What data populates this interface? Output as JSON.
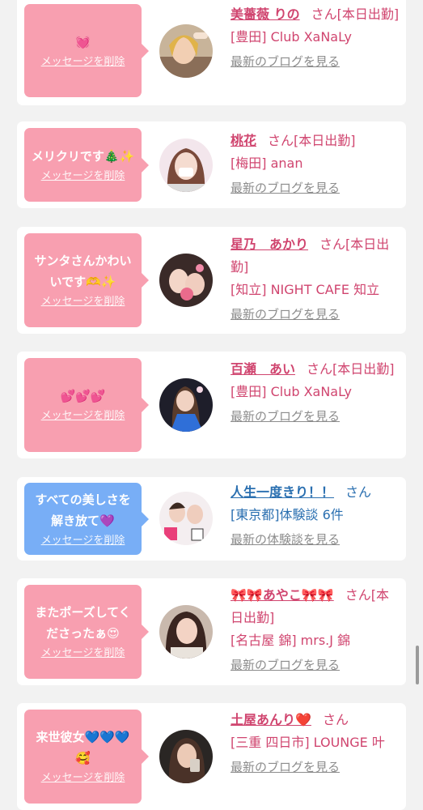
{
  "colors": {
    "page_bg": "#f2f2f2",
    "card_bg": "#ffffff",
    "bubble_pink": "#f89fb0",
    "bubble_blue": "#78aef6",
    "link_pink": "#d0456f",
    "link_blue": "#2a6fb0",
    "muted_link": "#8c8c8c"
  },
  "delete_label": "メッセージを削除",
  "messages": [
    {
      "message": "💓",
      "bubble_color": "pink",
      "name": "美薔薇 りの",
      "suffix": "さん[本日出勤]",
      "shop": "[豊田] Club XaNaLy",
      "link": "最新のブログを見る"
    },
    {
      "message": "メリクリです🎄✨",
      "bubble_color": "pink",
      "name": "桃花",
      "suffix": "さん[本日出勤]",
      "shop": "[梅田] anan",
      "link": "最新のブログを見る"
    },
    {
      "message": "サンタさんかわいいです🫶✨",
      "bubble_color": "pink",
      "name": "星乃　あかり",
      "suffix": "さん[本日出勤]",
      "shop": "[知立] NIGHT CAFE 知立",
      "link": "最新のブログを見る"
    },
    {
      "message": "💕💕💕",
      "bubble_color": "pink",
      "name": "百瀬　あい",
      "suffix": "さん[本日出勤]",
      "shop": "[豊田] Club XaNaLy",
      "link": "最新のブログを見る"
    },
    {
      "message": "すべての美しさを解き放て💜",
      "bubble_color": "blue",
      "name": "人生一度きり！！",
      "suffix": "さん",
      "shop": "[東京都]体験談 6件",
      "link": "最新の体験談を見る"
    },
    {
      "message": "またポーズしてくださったぁ😍",
      "bubble_color": "pink",
      "name": "🎀🎀あやこ🎀🎀",
      "suffix": "さん[本日出勤]",
      "shop": "[名古屋 錦] mrs.J 錦",
      "link": "最新のブログを見る"
    },
    {
      "message": "来世彼女💙💙💙🥰",
      "bubble_color": "pink",
      "name": "土屋あんり❤️",
      "suffix": "さん",
      "shop": "[三重 四日市] LOUNGE 叶",
      "link": "最新のブログを見る"
    }
  ]
}
